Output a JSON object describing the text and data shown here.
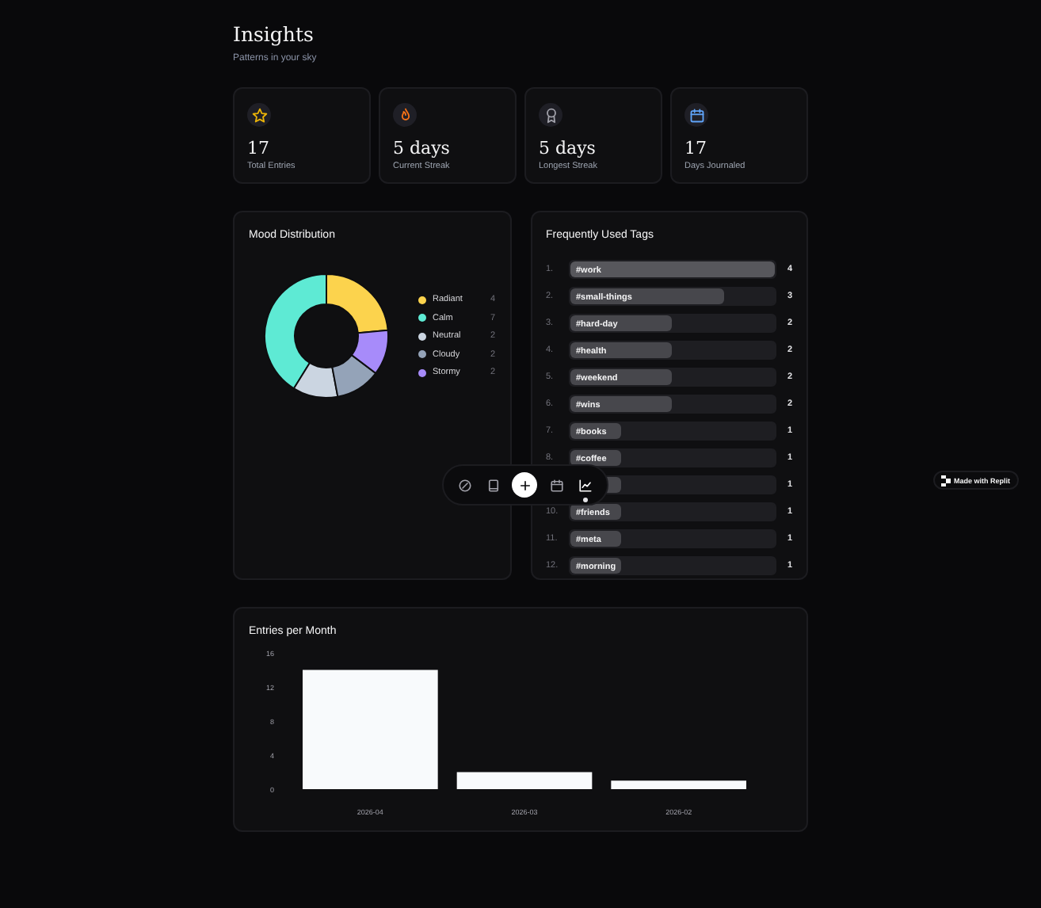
{
  "header": {
    "title": "Insights",
    "subtitle": "Patterns in your sky"
  },
  "stats": [
    {
      "value": "17",
      "label": "Total Entries"
    },
    {
      "value": "5 days",
      "label": "Current Streak"
    },
    {
      "value": "5 days",
      "label": "Longest Streak"
    },
    {
      "value": "17",
      "label": "Days Journaled"
    }
  ],
  "mood": {
    "title": "Mood Distribution",
    "legend": [
      {
        "label": "Radiant",
        "count": "4",
        "color": "#fcd34d"
      },
      {
        "label": "Calm",
        "count": "7",
        "color": "#5eead4"
      },
      {
        "label": "Neutral",
        "count": "2",
        "color": "#cbd5e1"
      },
      {
        "label": "Cloudy",
        "count": "2",
        "color": "#94a3b8"
      },
      {
        "label": "Stormy",
        "count": "2",
        "color": "#a78bfa"
      }
    ]
  },
  "tags": {
    "title": "Frequently Used Tags",
    "items": [
      {
        "rank": "1.",
        "label": "#work",
        "count": "4",
        "level": 1
      },
      {
        "rank": "2.",
        "label": "#small-things",
        "count": "3",
        "level": 0.75
      },
      {
        "rank": "3.",
        "label": "#hard-day",
        "count": "2",
        "level": 0.5
      },
      {
        "rank": "4.",
        "label": "#health",
        "count": "2",
        "level": 0.5
      },
      {
        "rank": "5.",
        "label": "#weekend",
        "count": "2",
        "level": 0.5
      },
      {
        "rank": "6.",
        "label": "#wins",
        "count": "2",
        "level": 0.5
      },
      {
        "rank": "7.",
        "label": "#books",
        "count": "1",
        "level": 0.25
      },
      {
        "rank": "8.",
        "label": "#coffee",
        "count": "1",
        "level": 0.25
      },
      {
        "count": "1",
        "level": 0.25
      },
      {
        "rank": "10.",
        "label": "#friends",
        "count": "1",
        "level": 0.25
      },
      {
        "rank": "11.",
        "label": "#meta",
        "count": "1",
        "level": 0.25
      },
      {
        "rank": "12.",
        "label": "#morning",
        "count": "1",
        "level": 0.25
      }
    ]
  },
  "entries": {
    "title": "Entries per Month",
    "chart_data": {
      "type": "bar",
      "categories": [
        "2026-04",
        "2026-03",
        "2026-02"
      ],
      "values": [
        14,
        2,
        1
      ],
      "ylim": [
        0,
        16
      ],
      "yticks": [
        0,
        4,
        8,
        12,
        16
      ]
    }
  },
  "nav": [
    {
      "selected": false
    },
    {
      "selected": false
    },
    {
      "selected": false
    },
    {
      "selected": false
    },
    {
      "selected": true
    }
  ],
  "badge": {
    "label": "Made with Replit"
  }
}
